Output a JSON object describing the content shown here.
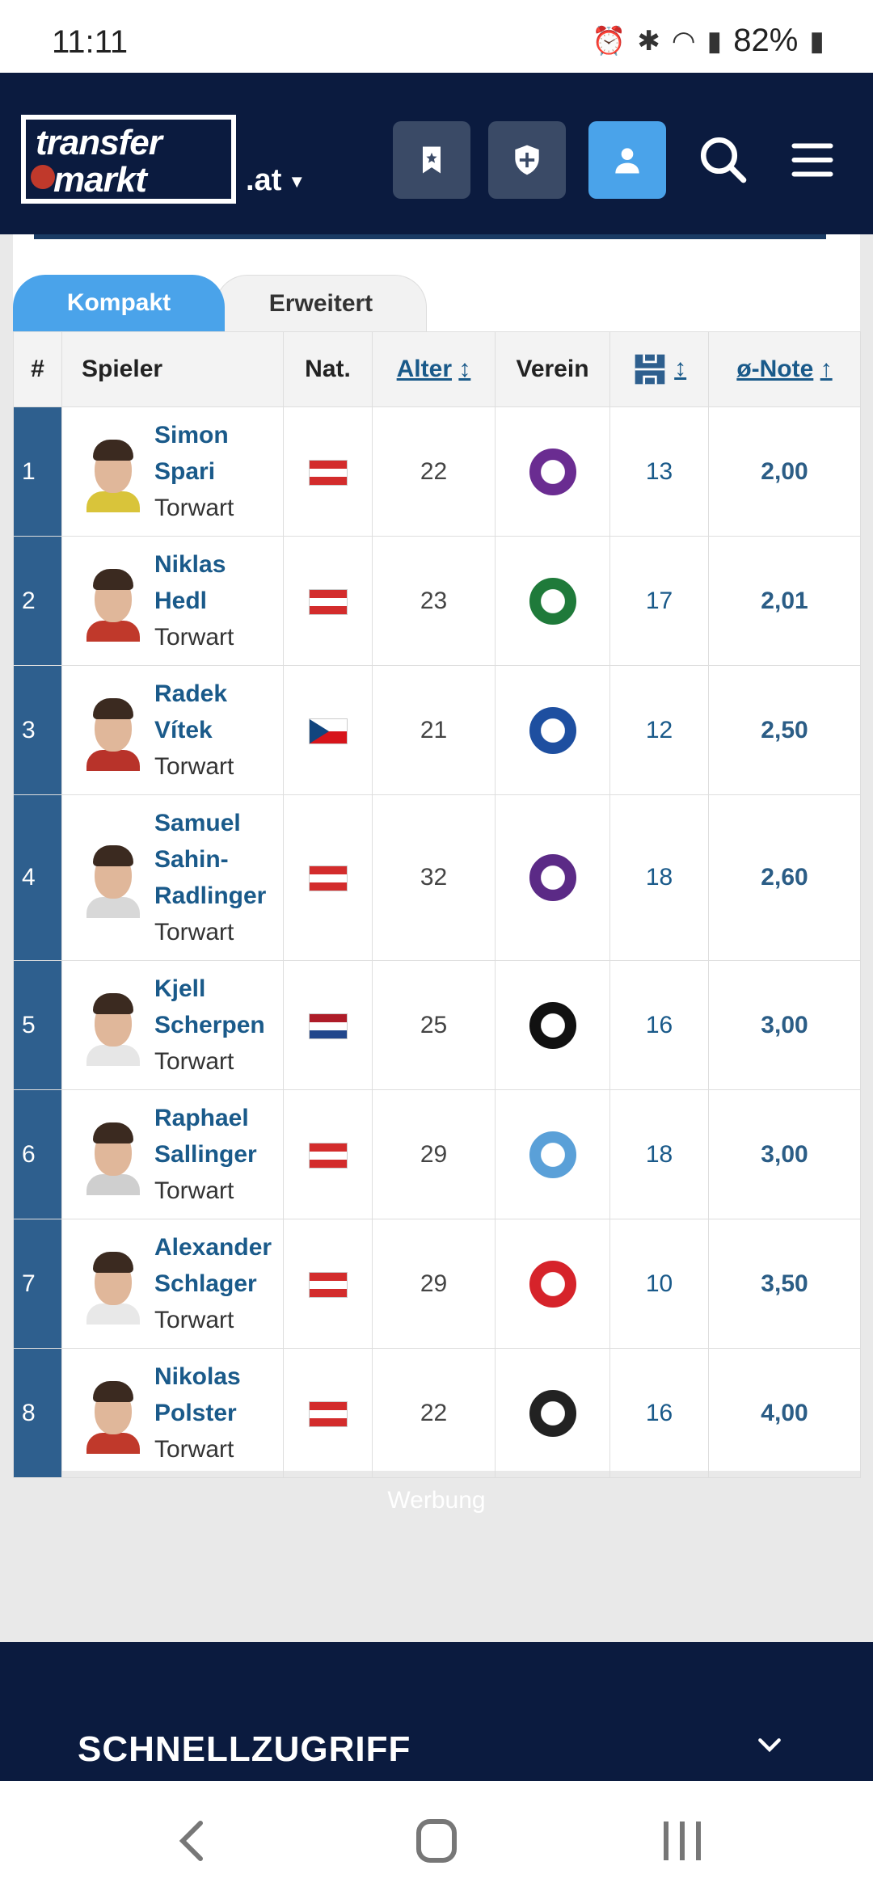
{
  "status_bar": {
    "time": "11:11",
    "battery": "82%",
    "icons": [
      "alarm-icon",
      "bluetooth-icon",
      "wifi-icon",
      "signal-icon",
      "battery-icon"
    ]
  },
  "header": {
    "logo_line1": "transfer",
    "logo_line2": "markt",
    "domain": ".at",
    "buttons": [
      "bookmark-icon",
      "shield-plus-icon",
      "user-icon",
      "search-icon",
      "menu-icon"
    ]
  },
  "tabs": {
    "compact": "Kompakt",
    "extended": "Erweitert"
  },
  "table": {
    "headers": {
      "rank": "#",
      "player": "Spieler",
      "nat": "Nat.",
      "age": "Alter",
      "age_sort": "↕",
      "club": "Verein",
      "apps_sort": "↕",
      "rating": "ø-Note",
      "rating_sort": "↑"
    },
    "rows": [
      {
        "rank": "1",
        "first": "Simon",
        "last": "Spari",
        "position": "Torwart",
        "nat": "AUT",
        "age": "22",
        "apps": "13",
        "rating": "2,00",
        "club_color": "#6a2c91",
        "shirt": "#d9c43a"
      },
      {
        "rank": "2",
        "first": "Niklas",
        "last": "Hedl",
        "position": "Torwart",
        "nat": "AUT",
        "age": "23",
        "apps": "17",
        "rating": "2,01",
        "club_color": "#1f7a3a",
        "shirt": "#c0392b"
      },
      {
        "rank": "3",
        "first": "Radek",
        "last": "Vítek",
        "position": "Torwart",
        "nat": "CZE",
        "age": "21",
        "apps": "12",
        "rating": "2,50",
        "club_color": "#1e4fa0",
        "shirt": "#b8332a"
      },
      {
        "rank": "4",
        "first": "Samuel",
        "last": "Sahin-Radlinger",
        "position": "Torwart",
        "nat": "AUT",
        "age": "32",
        "apps": "18",
        "rating": "2,60",
        "club_color": "#5b2a86",
        "shirt": "#d8d8d8"
      },
      {
        "rank": "5",
        "first": "Kjell",
        "last": "Scherpen",
        "position": "Torwart",
        "nat": "NED",
        "age": "25",
        "apps": "16",
        "rating": "3,00",
        "club_color": "#111111",
        "shirt": "#e6e6e6"
      },
      {
        "rank": "6",
        "first": "Raphael",
        "last": "Sallinger",
        "position": "Torwart",
        "nat": "AUT",
        "age": "29",
        "apps": "18",
        "rating": "3,00",
        "club_color": "#5aa0d8",
        "shirt": "#cfcfcf"
      },
      {
        "rank": "7",
        "first": "Alexander",
        "last": "Schlager",
        "position": "Torwart",
        "nat": "AUT",
        "age": "29",
        "apps": "10",
        "rating": "3,50",
        "club_color": "#d6232a",
        "shirt": "#e8e8e8"
      },
      {
        "rank": "8",
        "first": "Nikolas",
        "last": "Polster",
        "position": "Torwart",
        "nat": "AUT",
        "age": "22",
        "apps": "16",
        "rating": "4,00",
        "club_color": "#222222",
        "shirt": "#c0392b"
      }
    ]
  },
  "ad_label": "Werbung",
  "footer": {
    "title": "SCHNELLZUGRIFF"
  },
  "colors": {
    "header_bg": "#0b1b3f",
    "accent": "#4aa3ea",
    "rank_bg": "#2e5f8e",
    "link": "#1a5a8a"
  }
}
